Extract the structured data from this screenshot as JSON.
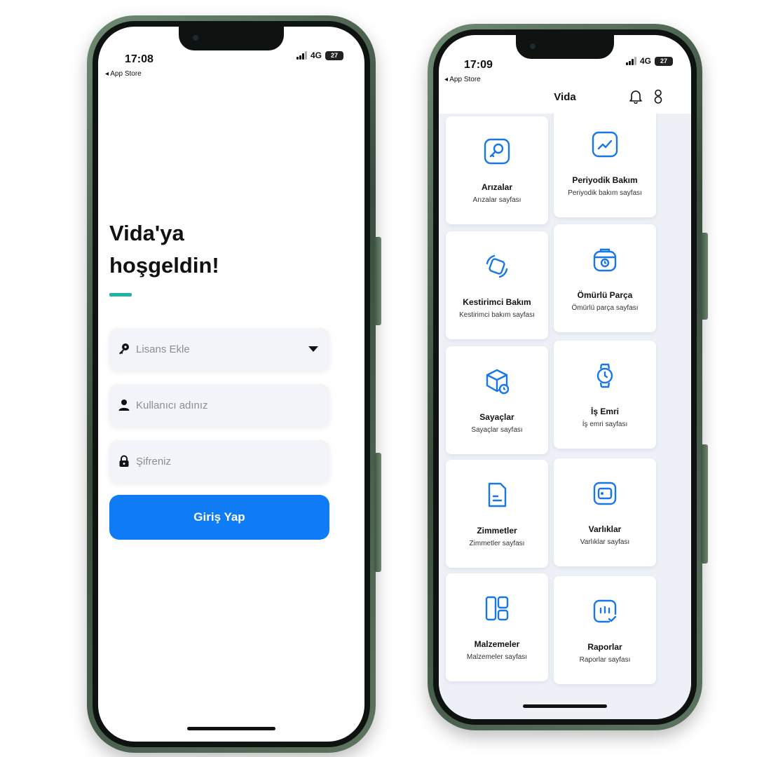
{
  "login_screen": {
    "status": {
      "time": "17:08",
      "back_label": "◂ App Store",
      "network": "4G",
      "battery": "27"
    },
    "welcome_line1": "Vida'ya",
    "welcome_line2": "hoşgeldin!",
    "license_placeholder": "Lisans Ekle",
    "username_placeholder": "Kullanıcı adınız",
    "password_placeholder": "Şifreniz",
    "login_button": "Giriş Yap",
    "colors": {
      "accent": "#1fb3a6",
      "primary": "#0f7bf5"
    }
  },
  "menu_screen": {
    "status": {
      "time": "17:09",
      "back_label": "◂ App Store",
      "network": "4G",
      "battery": "27"
    },
    "title": "Vida",
    "header_icons": [
      "bell-icon",
      "user-icon"
    ],
    "cards": [
      {
        "title": "Arızalar",
        "subtitle": "Arızalar sayfası",
        "icon": "key-icon"
      },
      {
        "title": "Periyodik Bakım",
        "subtitle": "Periyodik bakım sayfası",
        "icon": "chart-line-icon"
      },
      {
        "title": "Kestirimci Bakım",
        "subtitle": "Kestirimci bakım sayfası",
        "icon": "rotate-icon"
      },
      {
        "title": "Ömürlü Parça",
        "subtitle": "Ömürlü parça sayfası",
        "icon": "bag-timer-icon"
      },
      {
        "title": "Sayaçlar",
        "subtitle": "Sayaçlar sayfası",
        "icon": "box-clock-icon"
      },
      {
        "title": "İş Emri",
        "subtitle": "İş emri sayfası",
        "icon": "watch-icon"
      },
      {
        "title": "Zimmetler",
        "subtitle": "Zimmetler sayfası",
        "icon": "document-icon"
      },
      {
        "title": "Varlıklar",
        "subtitle": "Varlıklar sayfası",
        "icon": "wallet-icon"
      },
      {
        "title": "Malzemeler",
        "subtitle": "Malzemeler sayfası",
        "icon": "layout-icon"
      },
      {
        "title": "Raporlar",
        "subtitle": "Raporlar sayfası",
        "icon": "report-check-icon"
      }
    ],
    "colors": {
      "icon": "#1877e8",
      "background": "#eef0f8"
    }
  }
}
